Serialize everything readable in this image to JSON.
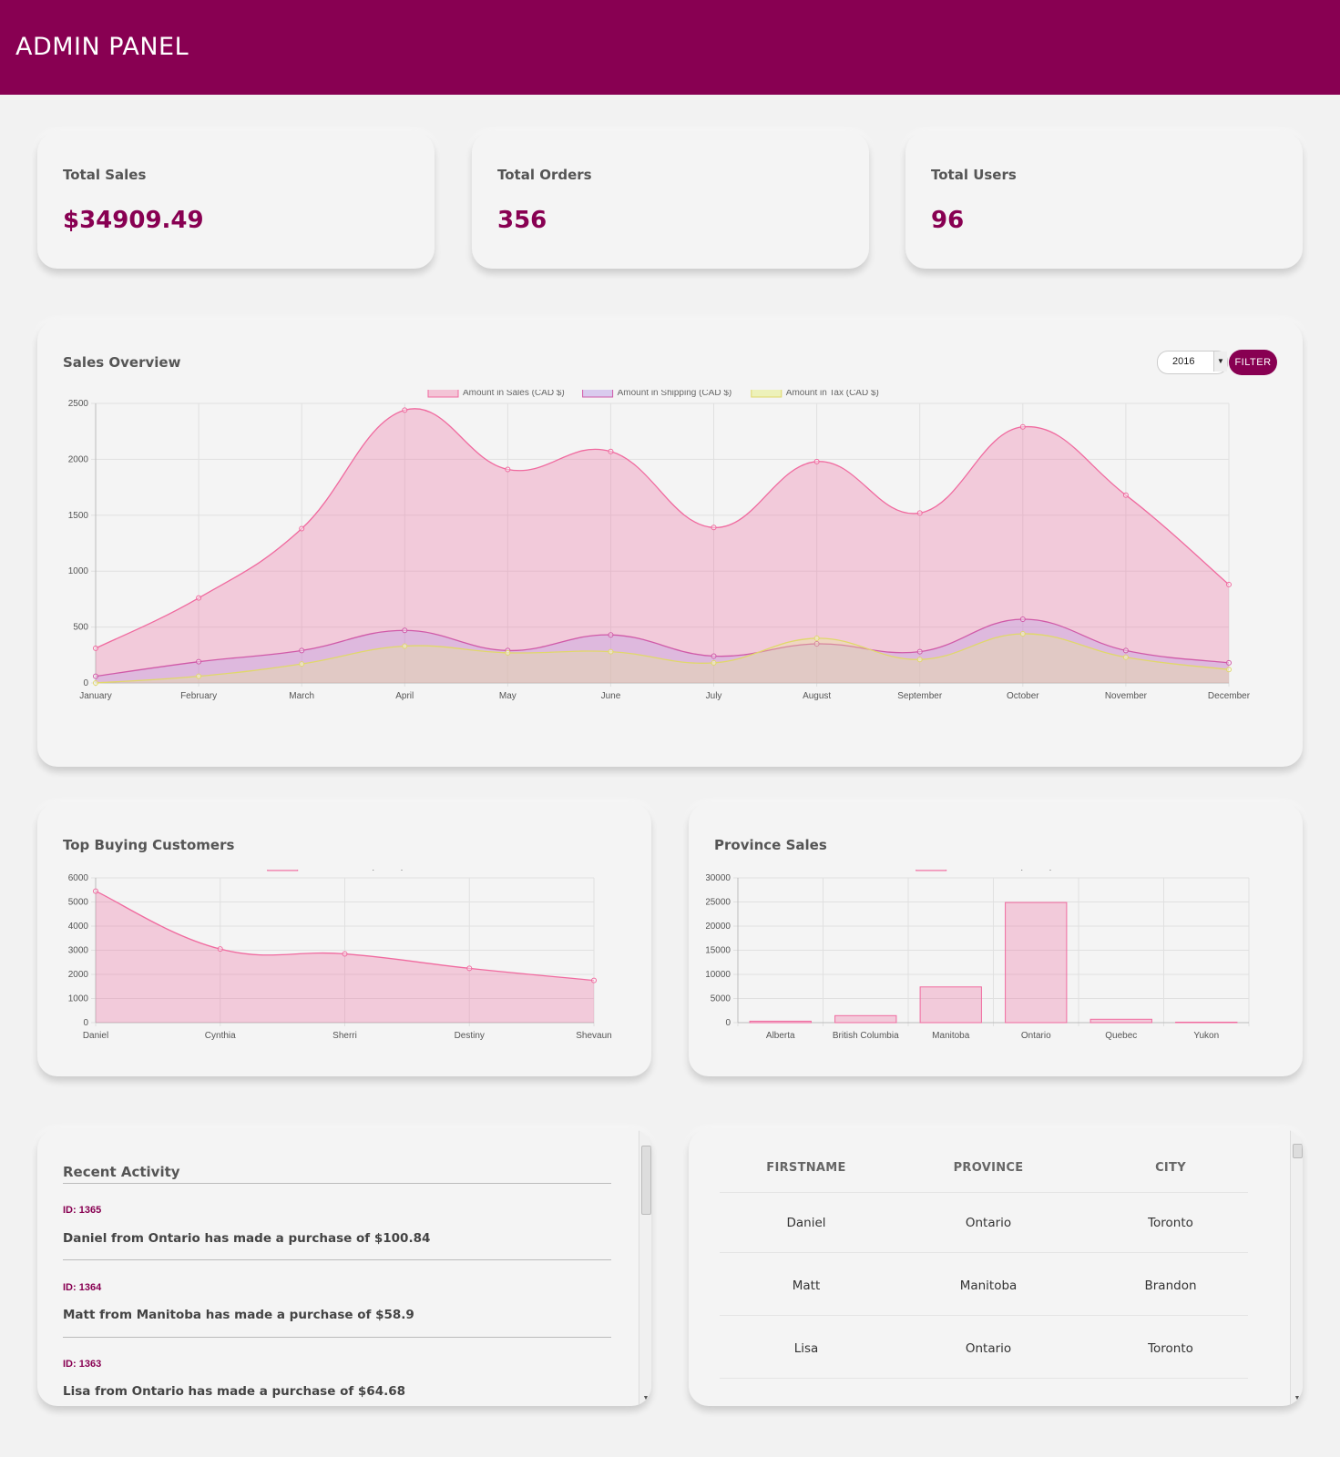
{
  "header": {
    "title": "ADMIN PANEL"
  },
  "stats": [
    {
      "label": "Total Sales",
      "value": "$34909.49"
    },
    {
      "label": "Total Orders",
      "value": "356"
    },
    {
      "label": "Total Users",
      "value": "96"
    }
  ],
  "sales_overview": {
    "title": "Sales Overview",
    "year": "2016",
    "filter_label": "FILTER"
  },
  "top_customers": {
    "title": "Top Buying Customers"
  },
  "province_sales": {
    "title": "Province Sales"
  },
  "recent_activity": {
    "title": "Recent Activity",
    "items": [
      {
        "id": "ID: 1365",
        "text": "Daniel from Ontario has made a purchase of $100.84"
      },
      {
        "id": "ID: 1364",
        "text": "Matt from Manitoba has made a purchase of $58.9"
      },
      {
        "id": "ID: 1363",
        "text": "Lisa from Ontario has made a purchase of $64.68"
      }
    ]
  },
  "user_table": {
    "columns": [
      "FIRSTNAME",
      "PROVINCE",
      "CITY"
    ],
    "rows": [
      [
        "Daniel",
        "Ontario",
        "Toronto"
      ],
      [
        "Matt",
        "Manitoba",
        "Brandon"
      ],
      [
        "Lisa",
        "Ontario",
        "Toronto"
      ]
    ]
  },
  "colors": {
    "brand": "#880052",
    "sales": "#f06a9f",
    "shipping": "#b99ae6",
    "tax": "#e8ee8a"
  },
  "chart_data": [
    {
      "type": "area",
      "categories": [
        "January",
        "February",
        "March",
        "April",
        "May",
        "June",
        "July",
        "August",
        "September",
        "October",
        "November",
        "December"
      ],
      "ylim": [
        0,
        2500
      ],
      "yticks": [
        0,
        500,
        1000,
        1500,
        2000,
        2500
      ],
      "legend_position": "top",
      "series": [
        {
          "name": "Amount in Sales (CAD $)",
          "values": [
            310,
            760,
            1380,
            2440,
            1910,
            2070,
            1390,
            1980,
            1520,
            2290,
            1680,
            880
          ]
        },
        {
          "name": "Amount in Shipping (CAD $)",
          "values": [
            60,
            190,
            290,
            470,
            290,
            430,
            240,
            350,
            280,
            570,
            290,
            180
          ]
        },
        {
          "name": "Amount in Tax (CAD $)",
          "values": [
            0,
            60,
            170,
            330,
            270,
            280,
            180,
            400,
            210,
            440,
            230,
            120
          ]
        }
      ]
    },
    {
      "type": "area",
      "categories": [
        "Daniel",
        "Cynthia",
        "Sherri",
        "Destiny",
        "Shevaun"
      ],
      "ylim": [
        0,
        6000
      ],
      "yticks": [
        0,
        1000,
        2000,
        3000,
        4000,
        5000,
        6000
      ],
      "legend_position": "top",
      "series": [
        {
          "name": "Amount in Sales (CAD $)",
          "values": [
            5450,
            3050,
            2850,
            2250,
            1750
          ]
        }
      ]
    },
    {
      "type": "bar",
      "categories": [
        "Alberta",
        "British Columbia",
        "Manitoba",
        "Ontario",
        "Quebec",
        "Yukon"
      ],
      "ylim": [
        0,
        30000
      ],
      "yticks": [
        0,
        5000,
        10000,
        15000,
        20000,
        25000,
        30000
      ],
      "legend_position": "top",
      "series": [
        {
          "name": "Amount in Sales (CAD $)",
          "values": [
            300,
            1450,
            7400,
            24900,
            700,
            100
          ]
        }
      ]
    }
  ]
}
